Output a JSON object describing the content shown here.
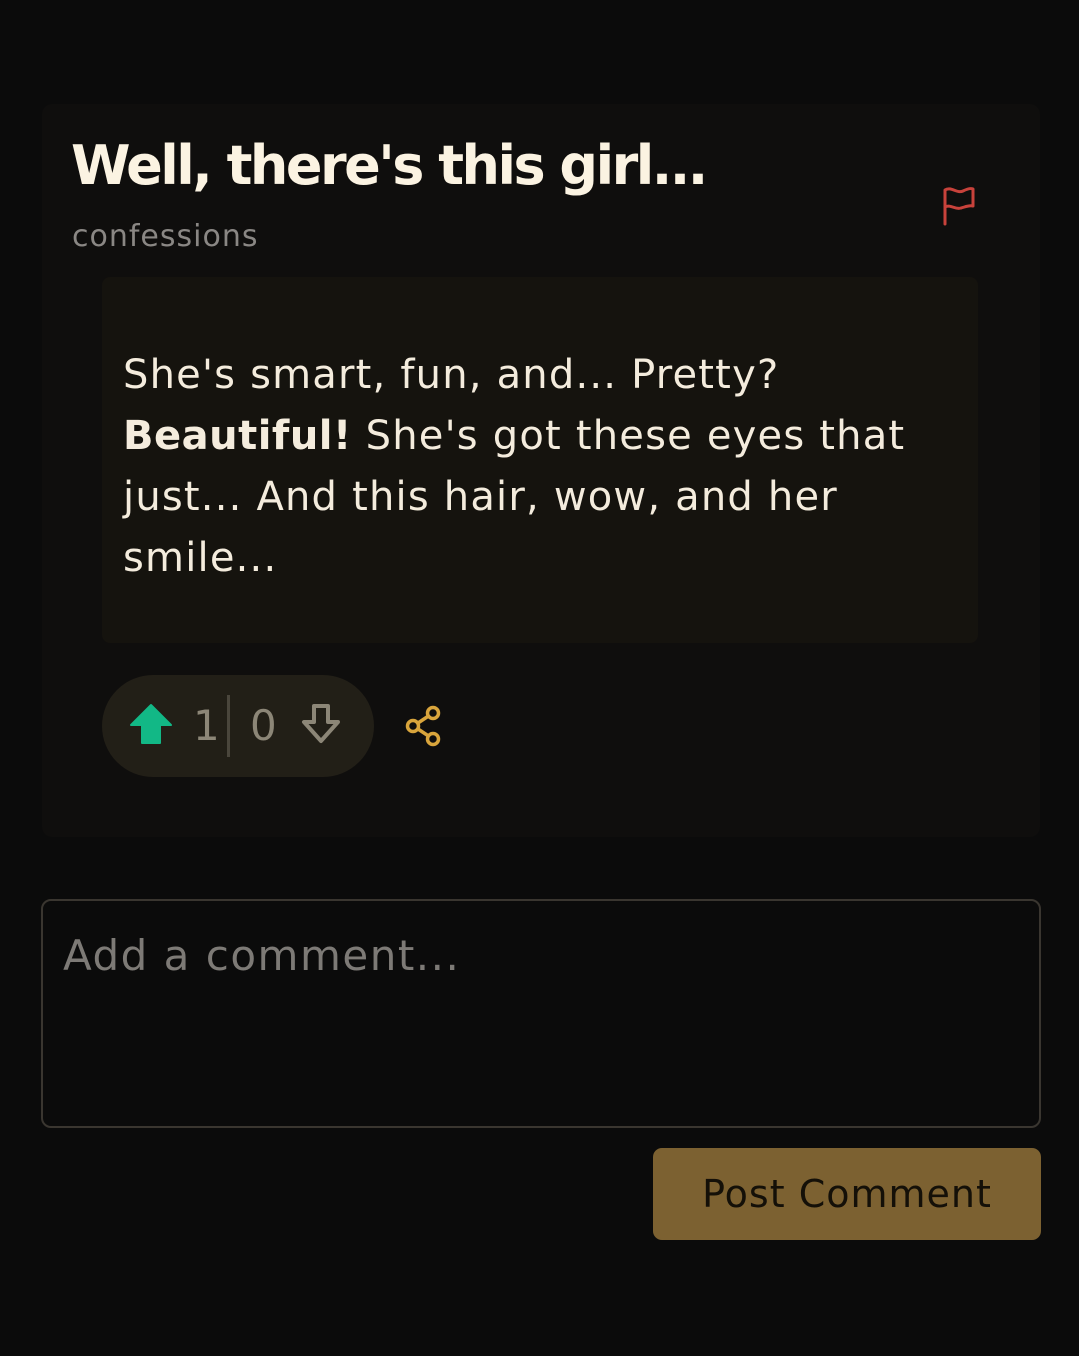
{
  "post": {
    "title": "Well, there's this girl...",
    "category": "confessions",
    "body": {
      "part1": "She's smart, fun, and... Pretty? ",
      "emphasis": "Beautiful!",
      "part2": " She's got these eyes that just... And this hair, wow, and her smile..."
    },
    "upvotes": "1",
    "downvotes": "0"
  },
  "icons": {
    "flag": "flag-icon",
    "upvote": "arrow-up-filled-icon",
    "downvote": "arrow-down-outline-icon",
    "share": "share-icon"
  },
  "colors": {
    "flag": "#c8423b",
    "upvote": "#12b886",
    "share": "#d9a53c",
    "button": "#7c6131"
  },
  "comment": {
    "placeholder": "Add a comment...",
    "value": "",
    "submit_label": "Post Comment"
  }
}
